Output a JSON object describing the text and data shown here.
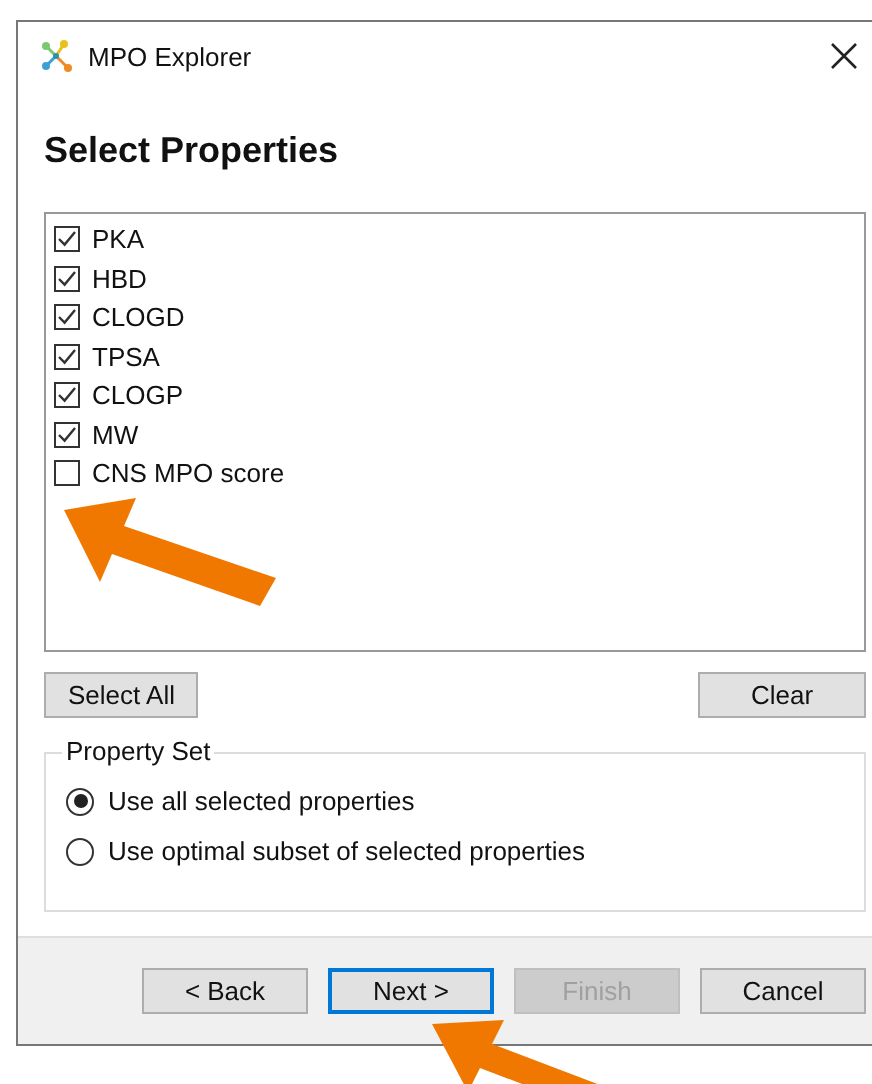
{
  "window": {
    "title": "MPO Explorer"
  },
  "heading": "Select Properties",
  "properties": [
    {
      "label": "PKA",
      "checked": true
    },
    {
      "label": "HBD",
      "checked": true
    },
    {
      "label": "CLOGD",
      "checked": true
    },
    {
      "label": "TPSA",
      "checked": true
    },
    {
      "label": "CLOGP",
      "checked": true
    },
    {
      "label": "MW",
      "checked": true
    },
    {
      "label": "CNS MPO score",
      "checked": false
    }
  ],
  "list_buttons": {
    "select_all": "Select All",
    "clear": "Clear"
  },
  "property_set": {
    "legend": "Property Set",
    "options": [
      {
        "label": "Use all selected properties",
        "selected": true
      },
      {
        "label": "Use optimal subset of selected properties",
        "selected": false
      }
    ]
  },
  "footer_buttons": [
    {
      "label": "< Back",
      "disabled": false,
      "focused": false
    },
    {
      "label": "Next >",
      "disabled": false,
      "focused": true
    },
    {
      "label": "Finish",
      "disabled": true,
      "focused": false
    },
    {
      "label": "Cancel",
      "disabled": false,
      "focused": false
    }
  ]
}
